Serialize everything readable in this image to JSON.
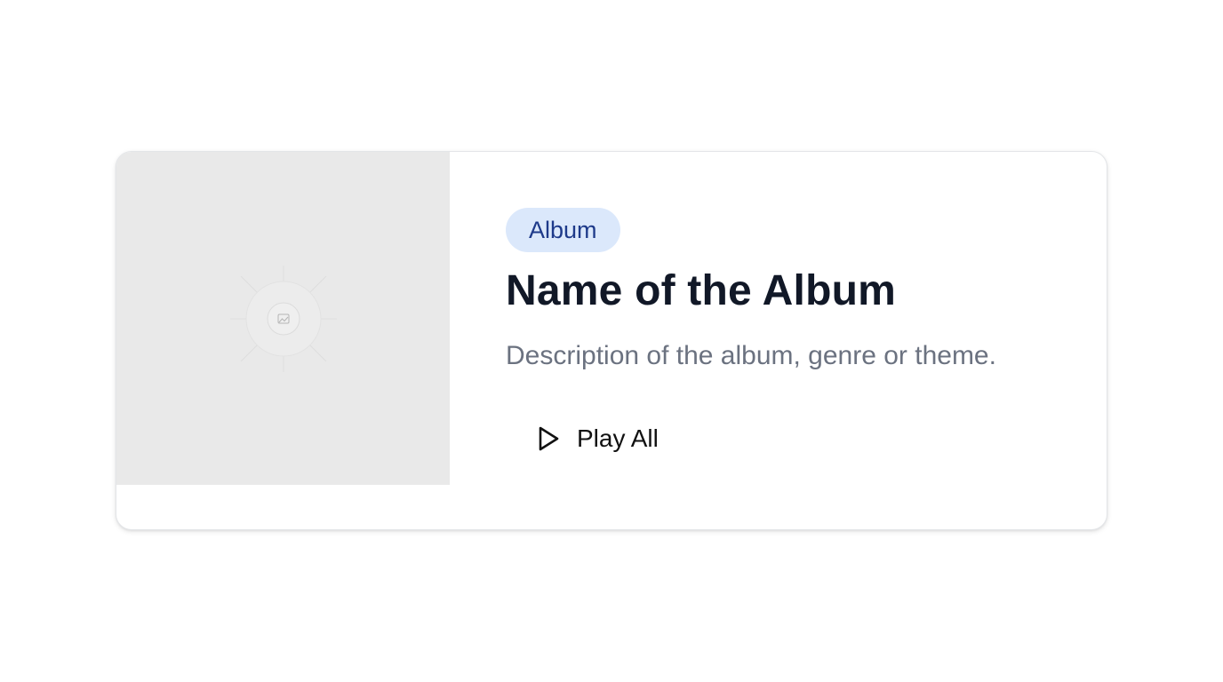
{
  "card": {
    "cover_image_icon": "image-placeholder-icon",
    "badge_label": "Album",
    "title": "Name of the Album",
    "description": "Description of the album, genre or theme.",
    "play_button": {
      "label": "Play All",
      "icon": "play-icon"
    }
  },
  "colors": {
    "cover_background": "#e9e9e9",
    "badge_background": "#dbe8fb",
    "badge_text": "#1e3a8a",
    "title_text": "#111827",
    "description_text": "#6b7280"
  }
}
